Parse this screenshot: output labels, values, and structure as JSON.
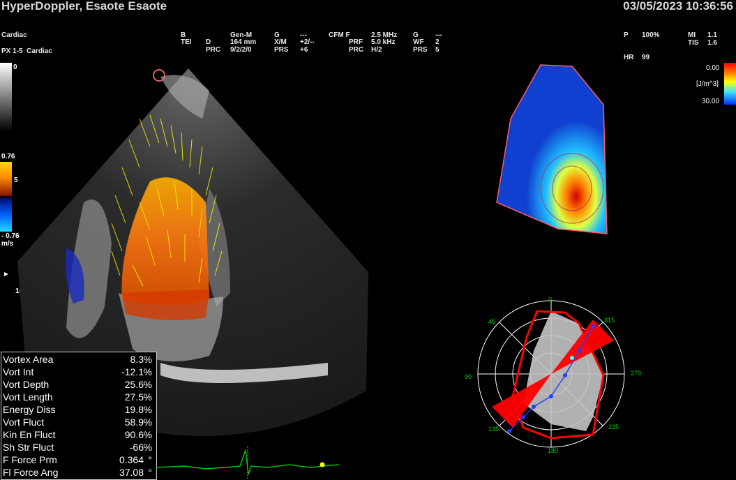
{
  "header": {
    "title": "HyperDoppler, Esaote Esaote",
    "preset": "Cardiac",
    "probe": "PX 1-5",
    "probe_app": "Cardiac",
    "datetime": "03/05/2023 10:36:56"
  },
  "params": {
    "b_tei": [
      "B",
      "TEI"
    ],
    "d_prc_labels": [
      "D",
      "PRC"
    ],
    "gen_values": [
      "Gen-M",
      "164 mm",
      "9/2/2/0"
    ],
    "g_labels": [
      "G",
      "X/M",
      "PRS"
    ],
    "g_values": [
      "---",
      "+2/--",
      "+6"
    ],
    "cfm_labels": [
      "CFM F",
      "PRF",
      "PRC"
    ],
    "cfm_values": [
      "2.5 MHz",
      "5.0 kHz",
      "H/2"
    ],
    "cfm_g_labels": [
      "G",
      "WF",
      "PRS"
    ],
    "cfm_g_values": [
      "---",
      "2",
      "5"
    ],
    "right_labels": [
      "P",
      "MI",
      "TIS"
    ],
    "right_values": [
      "100%",
      "1.1",
      "1.6"
    ],
    "hr_label": "HR",
    "hr_value": "99"
  },
  "scales": {
    "gray_top": "0",
    "color_top": "0.76",
    "color_mid": "5",
    "color_bottom": "- 0.76",
    "color_unit": "m/s",
    "depth_mark": "10",
    "energy_top": "0.00",
    "energy_unit": "[J/m^3]",
    "energy_bottom": "30.00"
  },
  "measurements": [
    {
      "label": "Vortex Area",
      "value": "8.3",
      "unit": "%"
    },
    {
      "label": "Vort Int",
      "value": "-12.1",
      "unit": "%"
    },
    {
      "label": "Vort Depth",
      "value": "25.6",
      "unit": "%"
    },
    {
      "label": "Vort Length",
      "value": "27.5",
      "unit": "%"
    },
    {
      "label": "Energy Diss",
      "value": "19.8",
      "unit": "%"
    },
    {
      "label": "Vort Fluct",
      "value": "58.9",
      "unit": "%"
    },
    {
      "label": "Kin En Fluct",
      "value": "90.6",
      "unit": "%"
    },
    {
      "label": "Sh Str Fluct",
      "value": "-66",
      "unit": "%"
    },
    {
      "label": "F Force Prm",
      "value": "0.364",
      "unit": "°"
    },
    {
      "label": "Fl Force Ang",
      "value": "37.08",
      "unit": "°"
    }
  ],
  "polar": {
    "labels": [
      "0",
      "315",
      "270",
      "225",
      "180",
      "135",
      "90",
      "45"
    ]
  },
  "colors": {
    "flow_arrows": "#f4f000",
    "flow_red": "#d43a00",
    "polar_red": "#ff0000",
    "ecg": "#00c000"
  }
}
